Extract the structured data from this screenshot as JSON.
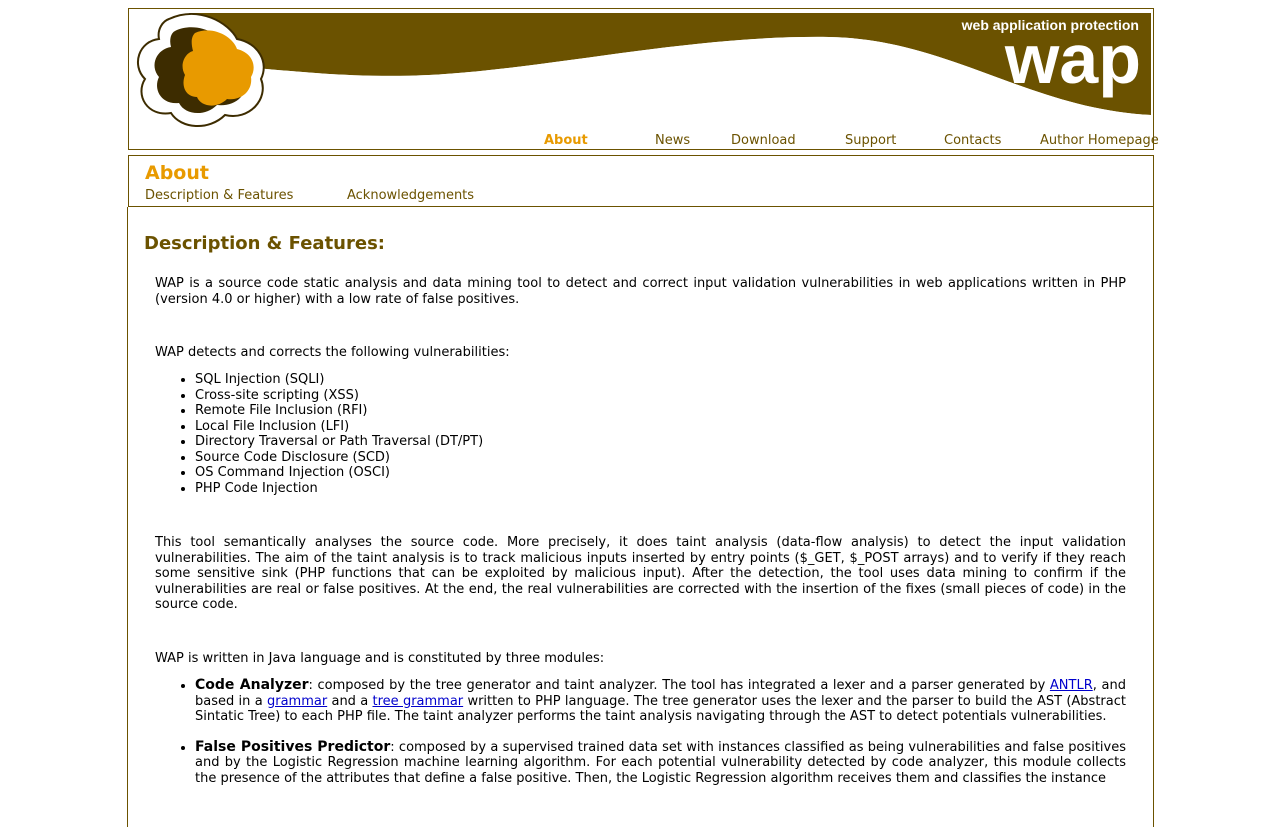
{
  "banner": {
    "tagline": "web application protection",
    "logo_text": "wap",
    "colors": {
      "brown": "#6b5200",
      "orange": "#e89a00"
    }
  },
  "nav": {
    "items": [
      {
        "label": "About",
        "active": true
      },
      {
        "label": "News"
      },
      {
        "label": "Download"
      },
      {
        "label": "Support"
      },
      {
        "label": "Contacts"
      },
      {
        "label": "Author Homepage"
      }
    ]
  },
  "subnav": {
    "title": "About",
    "links": [
      "Description & Features",
      "Acknowledgements"
    ]
  },
  "main": {
    "heading": "Description & Features:",
    "intro": "WAP is a source code static analysis and data mining tool to detect and correct input validation vulnerabilities in web applications written in PHP (version 4.0 or higher) with a low rate of false positives.",
    "detects_intro": "WAP detects and corrects the following vulnerabilities:",
    "vulnerabilities": [
      "SQL Injection (SQLI)",
      "Cross-site scripting (XSS)",
      "Remote File Inclusion (RFI)",
      "Local File Inclusion (LFI)",
      "Directory Traversal or Path Traversal (DT/PT)",
      "Source Code Disclosure (SCD)",
      "OS Command Injection (OSCI)",
      "PHP Code Injection"
    ],
    "analysis_paragraph": "This tool semantically analyses the source code. More precisely, it does taint analysis (data-flow analysis) to detect the input validation vulnerabilities. The aim of the taint analysis is to track malicious inputs inserted by entry points ($_GET, $_POST arrays) and to verify if they reach some sensitive sink (PHP functions that can be exploited by malicious input). After the detection, the tool uses data mining to confirm if the vulnerabilities are real or false positives. At the end, the real vulnerabilities are corrected with the insertion of the fixes (small pieces of code) in the source code.",
    "modules_intro": "WAP is written in Java language and is constituted by three modules:",
    "modules": [
      {
        "name": "Code Analyzer",
        "t1": ": composed by the tree generator and taint analyzer. The tool has integrated a lexer and a parser generated by ",
        "link1": "ANTLR",
        "t2": ", and based in a ",
        "link2": "grammar",
        "t3": " and a ",
        "link3": "tree grammar",
        "t4": " written to PHP language. The tree generator uses the lexer and the parser to build the AST (Abstract Sintatic Tree) to each PHP file. The taint analyzer performs the taint analysis navigating through the AST to detect potentials vulnerabilities."
      },
      {
        "name": "False Positives Predictor",
        "t1": ": composed by a supervised trained data set with instances classified as being vulnerabilities and false positives and by the Logistic Regression machine learning algorithm. For each potential vulnerability detected by code analyzer, this module collects the presence of the attributes that define a false positive. Then, the Logistic Regression algorithm receives them and classifies the instance"
      }
    ]
  }
}
